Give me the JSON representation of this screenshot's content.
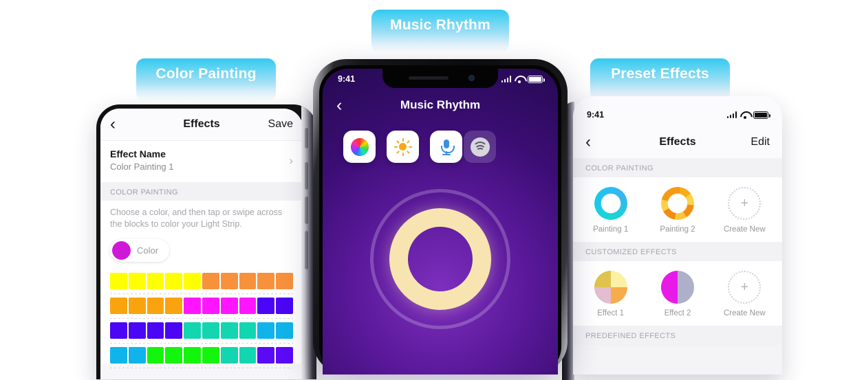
{
  "labels": {
    "color_painting": "Color Painting",
    "music_rhythm": "Music Rhythm",
    "preset_effects": "Preset Effects"
  },
  "left_phone": {
    "navbar": {
      "back": "‹",
      "title": "Effects",
      "action": "Save"
    },
    "effect_row": {
      "label": "Effect Name",
      "value": "Color Painting 1",
      "chevron": "›"
    },
    "section_header": "COLOR PAINTING",
    "help_text": "Choose a color, and then tap or swipe across the blocks to color your Light Strip.",
    "color_chip": {
      "label": "Color",
      "swatch": "#cf17d8"
    },
    "grid_rows": [
      [
        "#ffff00",
        "#ffff00",
        "#ffff00",
        "#ffff00",
        "#ffff00",
        "#f7913c",
        "#f7913c",
        "#f7913c",
        "#f7913c",
        "#f7913c"
      ],
      [
        "#f9a40e",
        "#f9a40e",
        "#f9a40e",
        "#f9a40e",
        "#ff16ff",
        "#ff16ff",
        "#ff16ff",
        "#ff16ff",
        "#4a06f5",
        "#4a06f5"
      ],
      [
        "#4a06f5",
        "#4a06f5",
        "#4a06f5",
        "#4a06f5",
        "#12d6b0",
        "#12d6b0",
        "#12d6b0",
        "#12d6b0",
        "#10b4ea",
        "#10b4ea"
      ],
      [
        "#10b4ea",
        "#10b4ea",
        "#14f50e",
        "#14f50e",
        "#14f50e",
        "#14f50e",
        "#12d6b0",
        "#12d6b0",
        "#5a0af5",
        "#5a0af5"
      ]
    ]
  },
  "center_phone": {
    "status": {
      "time": "9:41",
      "signal": "signal-bars-icon",
      "wifi": "wifi-icon",
      "battery": "battery-icon"
    },
    "navbar": {
      "back": "‹",
      "title": "Music Rhythm"
    },
    "icons": [
      {
        "name": "color-wheel-icon",
        "label": "Color"
      },
      {
        "name": "brightness-sun-icon",
        "label": "Brightness"
      },
      {
        "name": "microphone-icon",
        "label": "Microphone"
      },
      {
        "name": "spotify-icon",
        "label": "Spotify"
      }
    ],
    "ring": {
      "color": "#f7e4b0",
      "outer_color": "rgba(255,255,255,.22)"
    },
    "background": "#5b199b"
  },
  "right_phone": {
    "status": {
      "time": "9:41"
    },
    "navbar": {
      "back": "‹",
      "title": "Effects",
      "action": "Edit"
    },
    "sections": [
      {
        "header": "COLOR PAINTING",
        "items": [
          {
            "caption": "Painting 1",
            "style": "ring-paint1"
          },
          {
            "caption": "Painting 2",
            "style": "ring-paint2"
          },
          {
            "caption": "Create New",
            "style": "create-new",
            "plus": "+"
          }
        ]
      },
      {
        "header": "CUSTOMIZED EFFECTS",
        "items": [
          {
            "caption": "Effect 1",
            "style": "quad"
          },
          {
            "caption": "Effect 2",
            "style": "half"
          },
          {
            "caption": "Create New",
            "style": "create-new",
            "plus": "+"
          }
        ]
      },
      {
        "header": "PREDEFINED EFFECTS",
        "items": []
      }
    ]
  }
}
